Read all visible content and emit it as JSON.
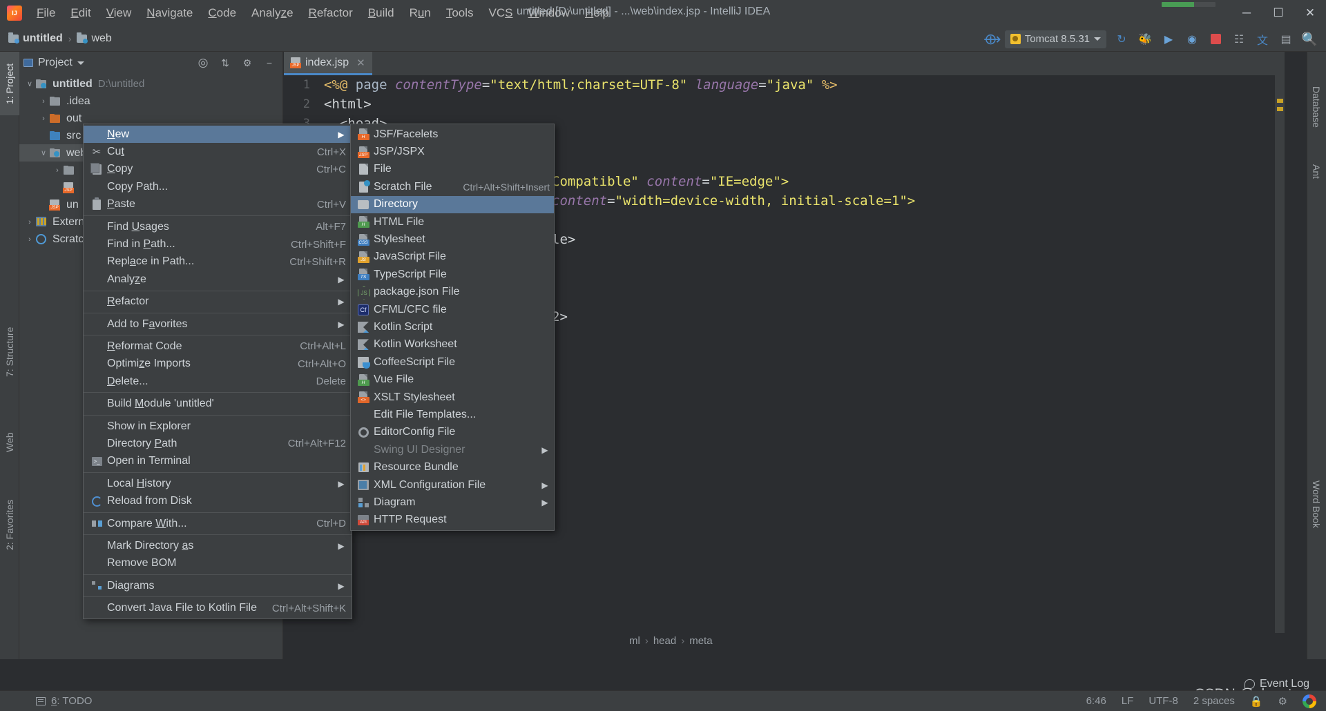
{
  "window": {
    "title": "untitled [D:\\untitled] - ...\\web\\index.jsp - IntelliJ IDEA",
    "minimize": "─",
    "maximize": "☐",
    "close": "✕"
  },
  "menubar": [
    {
      "label": "File"
    },
    {
      "label": "Edit"
    },
    {
      "label": "View"
    },
    {
      "label": "Navigate"
    },
    {
      "label": "Code"
    },
    {
      "label": "Analyze"
    },
    {
      "label": "Refactor"
    },
    {
      "label": "Build"
    },
    {
      "label": "Run"
    },
    {
      "label": "Tools"
    },
    {
      "label": "VCS"
    },
    {
      "label": "Window"
    },
    {
      "label": "Help"
    }
  ],
  "navbar": {
    "crumbs": [
      {
        "label": "untitled"
      },
      {
        "label": "web"
      }
    ],
    "separator": "›",
    "run_config": "Tomcat 8.5.31",
    "icons": [
      "hammer-icon",
      "rerun-icon",
      "debug-icon",
      "run-with-coverage-icon",
      "profile-icon",
      "stop-icon",
      "app-servers-icon",
      "translate-icon",
      "layout-icon",
      "search-icon"
    ]
  },
  "left_tool_strip": [
    {
      "label": "1: Project",
      "active": true
    },
    {
      "label": "7: Structure",
      "active": false
    },
    {
      "label": "Web",
      "active": false
    },
    {
      "label": "2: Favorites",
      "active": false
    }
  ],
  "right_tool_strip": [
    {
      "label": "Database"
    },
    {
      "label": "Ant"
    },
    {
      "label": "Word Book"
    }
  ],
  "project_panel": {
    "title": "Project",
    "header_icons": [
      "locate-icon",
      "collapse-all-icon",
      "settings-icon",
      "hide-icon"
    ],
    "tree": [
      {
        "indent": 0,
        "arrow": "∨",
        "icon": "module-folder-icon",
        "name": "untitled",
        "bold": true,
        "path": "D:\\untitled",
        "selected": false
      },
      {
        "indent": 1,
        "arrow": "›",
        "icon": "folder-gray-icon",
        "name": ".idea",
        "bold": false,
        "path": "",
        "selected": false
      },
      {
        "indent": 1,
        "arrow": "›",
        "icon": "folder-orange-icon",
        "name": "out",
        "bold": false,
        "path": "",
        "selected": false
      },
      {
        "indent": 1,
        "arrow": "",
        "icon": "folder-blue-icon",
        "name": "src",
        "bold": false,
        "path": "",
        "selected": false
      },
      {
        "indent": 1,
        "arrow": "∨",
        "icon": "folder-web-icon",
        "name": "web",
        "bold": false,
        "path": "",
        "selected": true
      },
      {
        "indent": 2,
        "arrow": "›",
        "icon": "folder-gray-icon",
        "name": "",
        "bold": false,
        "path": "",
        "selected": false
      },
      {
        "indent": 2,
        "arrow": "",
        "icon": "jsp-file-icon",
        "name": "",
        "bold": false,
        "path": "",
        "selected": false
      },
      {
        "indent": 1,
        "arrow": "",
        "icon": "jsp-file-icon",
        "name": "un",
        "bold": false,
        "path": "",
        "selected": false
      },
      {
        "indent": 0,
        "arrow": "›",
        "icon": "library-icon",
        "name": "Extern",
        "bold": false,
        "path": "",
        "selected": false
      },
      {
        "indent": 0,
        "arrow": "›",
        "icon": "scratch-icon",
        "name": "Scratc",
        "bold": false,
        "path": "",
        "selected": false
      }
    ]
  },
  "editor": {
    "tab": {
      "label": "index.jsp",
      "close": "✕",
      "icon": "jsp-file-icon"
    },
    "lines": [
      {
        "num": "1",
        "segments": [
          {
            "t": "<%@ ",
            "c": "dir"
          },
          {
            "t": "page ",
            "c": "plain"
          },
          {
            "t": "contentType",
            "c": "attr"
          },
          {
            "t": "=",
            "c": "white"
          },
          {
            "t": "\"text/html;charset=UTF-8\" ",
            "c": "str"
          },
          {
            "t": "language",
            "c": "attr"
          },
          {
            "t": "=",
            "c": "white"
          },
          {
            "t": "\"java\" ",
            "c": "str"
          },
          {
            "t": "%>",
            "c": "dir"
          }
        ]
      },
      {
        "num": "2",
        "segments": [
          {
            "t": "<html>",
            "c": "white"
          }
        ]
      },
      {
        "num": "3",
        "segments": [
          {
            "t": "  <head>",
            "c": "white"
          }
        ]
      },
      {
        "num": "4",
        "segments": [
          {
            "t": "",
            "c": "white"
          }
        ]
      },
      {
        "num": "5",
        "segments": [
          {
            "t": "",
            "c": "white"
          }
        ]
      },
      {
        "num": "6",
        "segments": [
          {
            "t": "Compatible\" ",
            "c": "str"
          },
          {
            "t": "content",
            "c": "attr"
          },
          {
            "t": "=",
            "c": "white"
          },
          {
            "t": "\"IE=edge\">",
            "c": "str"
          }
        ]
      },
      {
        "num": "7",
        "segments": [
          {
            "t": "content",
            "c": "attr"
          },
          {
            "t": "=",
            "c": "white"
          },
          {
            "t": "\"width=device-width, initial-scale=1\">",
            "c": "str"
          }
        ]
      },
      {
        "num": "8",
        "segments": [
          {
            "t": "",
            "c": "white"
          }
        ]
      },
      {
        "num": "9",
        "segments": [
          {
            "t": "le>",
            "c": "white"
          }
        ]
      },
      {
        "num": "10",
        "segments": [
          {
            "t": "",
            "c": "white"
          }
        ]
      },
      {
        "num": "11",
        "segments": [
          {
            "t": "",
            "c": "white"
          }
        ]
      },
      {
        "num": "12",
        "segments": [
          {
            "t": "",
            "c": "white"
          }
        ]
      },
      {
        "num": "13",
        "segments": [
          {
            "t": "2>",
            "c": "white"
          }
        ]
      }
    ],
    "breadcrumb": [
      "ml",
      "head",
      "meta"
    ],
    "breadcrumb_sep": "›"
  },
  "context_menu": {
    "items": [
      {
        "label": "New",
        "accel": "",
        "icon": "",
        "submenu": true,
        "highlight": true,
        "sep_after": false,
        "mn": "N"
      },
      {
        "label": "Cut",
        "accel": "Ctrl+X",
        "icon": "scissors-icon",
        "submenu": false,
        "highlight": false,
        "sep_after": false,
        "mn": "t"
      },
      {
        "label": "Copy",
        "accel": "Ctrl+C",
        "icon": "copy-icon",
        "submenu": false,
        "highlight": false,
        "sep_after": false,
        "mn": "C"
      },
      {
        "label": "Copy Path...",
        "accel": "",
        "icon": "",
        "submenu": false,
        "highlight": false,
        "sep_after": false,
        "mn": ""
      },
      {
        "label": "Paste",
        "accel": "Ctrl+V",
        "icon": "paste-icon",
        "submenu": false,
        "highlight": false,
        "sep_after": true,
        "mn": "P"
      },
      {
        "label": "Find Usages",
        "accel": "Alt+F7",
        "icon": "",
        "submenu": false,
        "highlight": false,
        "sep_after": false,
        "mn": "U"
      },
      {
        "label": "Find in Path...",
        "accel": "Ctrl+Shift+F",
        "icon": "",
        "submenu": false,
        "highlight": false,
        "sep_after": false,
        "mn": "P"
      },
      {
        "label": "Replace in Path...",
        "accel": "Ctrl+Shift+R",
        "icon": "",
        "submenu": false,
        "highlight": false,
        "sep_after": false,
        "mn": "a"
      },
      {
        "label": "Analyze",
        "accel": "",
        "icon": "",
        "submenu": true,
        "highlight": false,
        "sep_after": true,
        "mn": "z"
      },
      {
        "label": "Refactor",
        "accel": "",
        "icon": "",
        "submenu": true,
        "highlight": false,
        "sep_after": true,
        "mn": "R"
      },
      {
        "label": "Add to Favorites",
        "accel": "",
        "icon": "",
        "submenu": true,
        "highlight": false,
        "sep_after": true,
        "mn": "a"
      },
      {
        "label": "Reformat Code",
        "accel": "Ctrl+Alt+L",
        "icon": "",
        "submenu": false,
        "highlight": false,
        "sep_after": false,
        "mn": "R"
      },
      {
        "label": "Optimize Imports",
        "accel": "Ctrl+Alt+O",
        "icon": "",
        "submenu": false,
        "highlight": false,
        "sep_after": false,
        "mn": "z"
      },
      {
        "label": "Delete...",
        "accel": "Delete",
        "icon": "",
        "submenu": false,
        "highlight": false,
        "sep_after": true,
        "mn": "D"
      },
      {
        "label": "Build Module 'untitled'",
        "accel": "",
        "icon": "",
        "submenu": false,
        "highlight": false,
        "sep_after": true,
        "mn": "M"
      },
      {
        "label": "Show in Explorer",
        "accel": "",
        "icon": "",
        "submenu": false,
        "highlight": false,
        "sep_after": false,
        "mn": ""
      },
      {
        "label": "Directory Path",
        "accel": "Ctrl+Alt+F12",
        "icon": "",
        "submenu": false,
        "highlight": false,
        "sep_after": false,
        "mn": "P"
      },
      {
        "label": "Open in Terminal",
        "accel": "",
        "icon": "terminal-icon",
        "submenu": false,
        "highlight": false,
        "sep_after": true,
        "mn": ""
      },
      {
        "label": "Local History",
        "accel": "",
        "icon": "",
        "submenu": true,
        "highlight": false,
        "sep_after": false,
        "mn": "H"
      },
      {
        "label": "Reload from Disk",
        "accel": "",
        "icon": "reload-icon",
        "submenu": false,
        "highlight": false,
        "sep_after": true,
        "mn": ""
      },
      {
        "label": "Compare With...",
        "accel": "Ctrl+D",
        "icon": "compare-icon",
        "submenu": false,
        "highlight": false,
        "sep_after": true,
        "mn": "W"
      },
      {
        "label": "Mark Directory as",
        "accel": "",
        "icon": "",
        "submenu": true,
        "highlight": false,
        "sep_after": false,
        "mn": "a"
      },
      {
        "label": "Remove BOM",
        "accel": "",
        "icon": "",
        "submenu": false,
        "highlight": false,
        "sep_after": true,
        "mn": ""
      },
      {
        "label": "Diagrams",
        "accel": "",
        "icon": "diagrams-icon",
        "submenu": true,
        "highlight": false,
        "sep_after": true,
        "mn": ""
      },
      {
        "label": "Convert Java File to Kotlin File",
        "accel": "Ctrl+Alt+Shift+K",
        "icon": "",
        "submenu": false,
        "highlight": false,
        "sep_after": false,
        "mn": ""
      }
    ]
  },
  "new_submenu": {
    "items": [
      {
        "label": "JSF/Facelets",
        "accel": "",
        "icon": "jsf-file-icon",
        "submenu": false,
        "highlight": false,
        "dim": false,
        "sep_after": false
      },
      {
        "label": "JSP/JSPX",
        "accel": "",
        "icon": "jsp-file-icon",
        "submenu": false,
        "highlight": false,
        "dim": false,
        "sep_after": false
      },
      {
        "label": "File",
        "accel": "",
        "icon": "file-icon",
        "submenu": false,
        "highlight": false,
        "dim": false,
        "sep_after": false
      },
      {
        "label": "Scratch File",
        "accel": "Ctrl+Alt+Shift+Insert",
        "icon": "scratch-file-icon",
        "submenu": false,
        "highlight": false,
        "dim": false,
        "sep_after": false
      },
      {
        "label": "Directory",
        "accel": "",
        "icon": "directory-icon",
        "submenu": false,
        "highlight": true,
        "dim": false,
        "sep_after": false
      },
      {
        "label": "HTML File",
        "accel": "",
        "icon": "html-file-icon",
        "submenu": false,
        "highlight": false,
        "dim": false,
        "sep_after": false
      },
      {
        "label": "Stylesheet",
        "accel": "",
        "icon": "css-file-icon",
        "submenu": false,
        "highlight": false,
        "dim": false,
        "sep_after": false
      },
      {
        "label": "JavaScript File",
        "accel": "",
        "icon": "js-file-icon",
        "submenu": false,
        "highlight": false,
        "dim": false,
        "sep_after": false
      },
      {
        "label": "TypeScript File",
        "accel": "",
        "icon": "ts-file-icon",
        "submenu": false,
        "highlight": false,
        "dim": false,
        "sep_after": false
      },
      {
        "label": "package.json File",
        "accel": "",
        "icon": "node-package-icon",
        "submenu": false,
        "highlight": false,
        "dim": false,
        "sep_after": false
      },
      {
        "label": "CFML/CFC file",
        "accel": "",
        "icon": "cfml-file-icon",
        "submenu": false,
        "highlight": false,
        "dim": false,
        "sep_after": false
      },
      {
        "label": "Kotlin Script",
        "accel": "",
        "icon": "kotlin-file-icon",
        "submenu": false,
        "highlight": false,
        "dim": false,
        "sep_after": false
      },
      {
        "label": "Kotlin Worksheet",
        "accel": "",
        "icon": "kotlin-file-icon",
        "submenu": false,
        "highlight": false,
        "dim": false,
        "sep_after": false
      },
      {
        "label": "CoffeeScript File",
        "accel": "",
        "icon": "coffeescript-file-icon",
        "submenu": false,
        "highlight": false,
        "dim": false,
        "sep_after": false
      },
      {
        "label": "Vue File",
        "accel": "",
        "icon": "vue-file-icon",
        "submenu": false,
        "highlight": false,
        "dim": false,
        "sep_after": false
      },
      {
        "label": "XSLT Stylesheet",
        "accel": "",
        "icon": "xslt-file-icon",
        "submenu": false,
        "highlight": false,
        "dim": false,
        "sep_after": false
      },
      {
        "label": "Edit File Templates...",
        "accel": "",
        "icon": "",
        "submenu": false,
        "highlight": false,
        "dim": false,
        "sep_after": false
      },
      {
        "label": "EditorConfig File",
        "accel": "",
        "icon": "gear-icon",
        "submenu": false,
        "highlight": false,
        "dim": false,
        "sep_after": false
      },
      {
        "label": "Swing UI Designer",
        "accel": "",
        "icon": "",
        "submenu": true,
        "highlight": false,
        "dim": true,
        "sep_after": false
      },
      {
        "label": "Resource Bundle",
        "accel": "",
        "icon": "resource-bundle-icon",
        "submenu": false,
        "highlight": false,
        "dim": false,
        "sep_after": false
      },
      {
        "label": "XML Configuration File",
        "accel": "",
        "icon": "xml-file-icon",
        "submenu": true,
        "highlight": false,
        "dim": false,
        "sep_after": false
      },
      {
        "label": "Diagram",
        "accel": "",
        "icon": "diagram-icon",
        "submenu": true,
        "highlight": false,
        "dim": false,
        "sep_after": false
      },
      {
        "label": "HTTP Request",
        "accel": "",
        "icon": "http-request-icon",
        "submenu": false,
        "highlight": false,
        "dim": false,
        "sep_after": false
      }
    ]
  },
  "status_bar": {
    "todo": "6: TODO",
    "event_log": "Event Log",
    "caret": "6:46",
    "line_sep": "LF",
    "encoding": "UTF-8",
    "indent": "2 spaces",
    "watermark": "CSDN @sky-stars"
  }
}
